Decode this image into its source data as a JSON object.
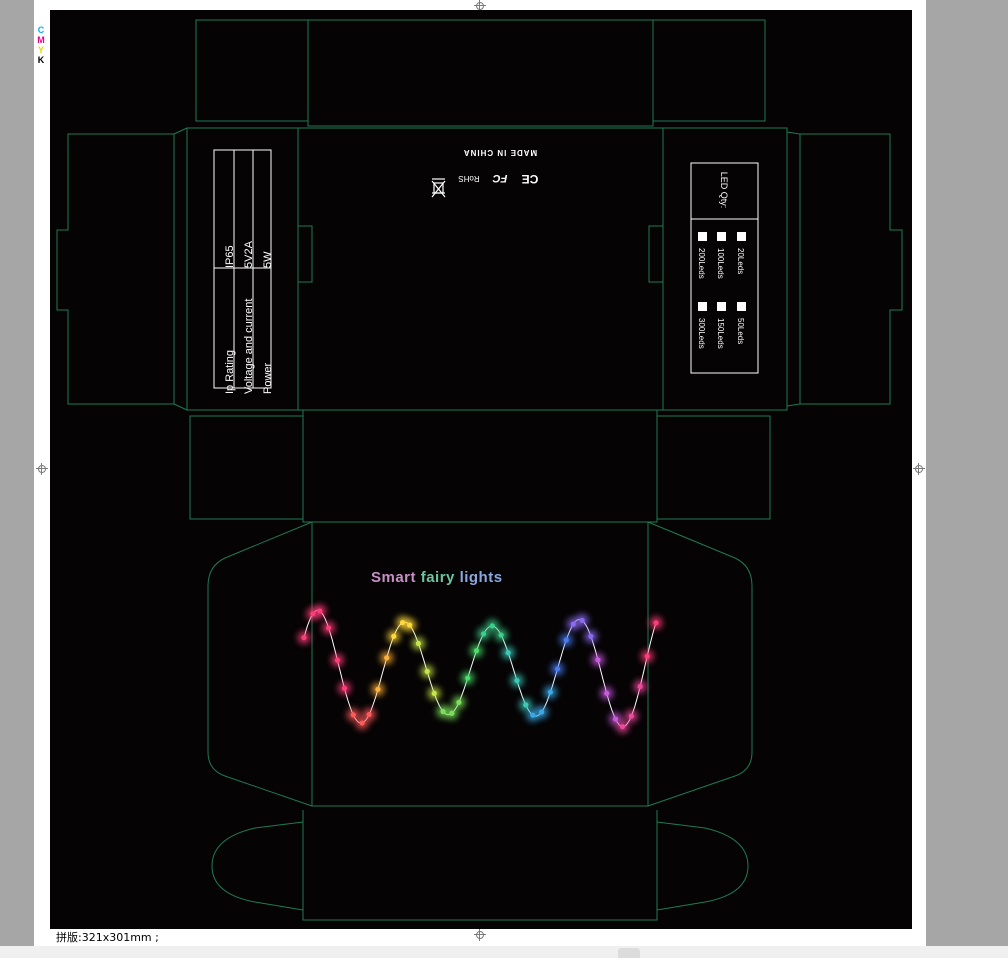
{
  "status_bar": {
    "sheet_size": "拼版:321x301mm ;"
  },
  "cmyk_marks": [
    {
      "letter": "C",
      "color": "#00aeef"
    },
    {
      "letter": "M",
      "color": "#ec008c"
    },
    {
      "letter": "Y",
      "color": "#fff200"
    },
    {
      "letter": "K",
      "color": "#000000"
    }
  ],
  "front_panel": {
    "title_words": [
      {
        "text": "Smart",
        "color": "#c98ec6"
      },
      {
        "text": "fairy",
        "color": "#6fc3a0"
      },
      {
        "text": "lights",
        "color": "#8aa8e0"
      }
    ]
  },
  "spec_panel": {
    "rows": [
      {
        "label": "Ip Rating",
        "value": "IP65"
      },
      {
        "label": "Voltage and current",
        "value": "5V2A"
      },
      {
        "label": "Power",
        "value": "5W"
      }
    ]
  },
  "cert_panel": {
    "made_in": "MADE IN CHINA",
    "marks": [
      "CE",
      "FC",
      "RoHS",
      "WEEE"
    ]
  },
  "qty_panel": {
    "heading": "LED Qty:",
    "options": [
      "20Leds",
      "50Leds",
      "100Leds",
      "150Leds",
      "200Leds",
      "300Leds"
    ]
  },
  "colors": {
    "dieline": "#1f7a55",
    "background": "#050304",
    "text": "#ffffff"
  }
}
